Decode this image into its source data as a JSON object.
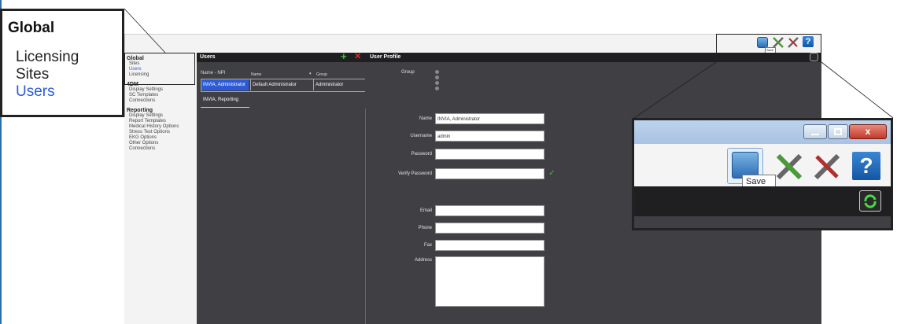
{
  "nav": {
    "global_heading": "Global",
    "global_items": [
      "Sites",
      "Users",
      "Licensing"
    ],
    "fourdm_heading": "4DM",
    "fourdm_items": [
      "Display Settings",
      "SC Templates",
      "Connections"
    ],
    "reporting_heading": "Reporting",
    "reporting_items": [
      "Display Settings",
      "Report Templates",
      "Medical History Options",
      "Stress Test Options",
      "EKG Options",
      "Other Options",
      "Connections"
    ]
  },
  "users_panel": {
    "title": "Users",
    "col_name_npi": "Name - NPI",
    "col_name": "Name",
    "col_group": "Group",
    "rows": [
      {
        "name_npi": "INVIA, Administrator",
        "name": "Default Administrator",
        "group": "Administrator"
      },
      {
        "name_npi": "INVIA, Reporting",
        "name": "",
        "group": ""
      }
    ]
  },
  "profile": {
    "title": "User Profile",
    "group_label": "Group",
    "labels": {
      "name": "Name",
      "username": "Username",
      "password": "Password",
      "verify_password": "Verify Password",
      "email": "Email",
      "phone": "Phone",
      "fax": "Fax",
      "address": "Address"
    },
    "values": {
      "name": "INVIA, Administrator",
      "username": "admin",
      "password": "",
      "verify_password": "",
      "email": "",
      "phone": "",
      "fax": "",
      "address": ""
    }
  },
  "toolbar": {
    "save_tooltip": "Save",
    "help_glyph": "?"
  },
  "zoom_left": {
    "title": "Global",
    "items": [
      "Licensing",
      "Sites",
      "Users"
    ]
  },
  "zoom_right": {
    "save_tooltip": "Save",
    "help_glyph": "?"
  },
  "colors": {
    "accent": "#2d5bd6",
    "panel": "#3f3f44",
    "header": "#1f1f22",
    "check": "#3cc43c"
  }
}
